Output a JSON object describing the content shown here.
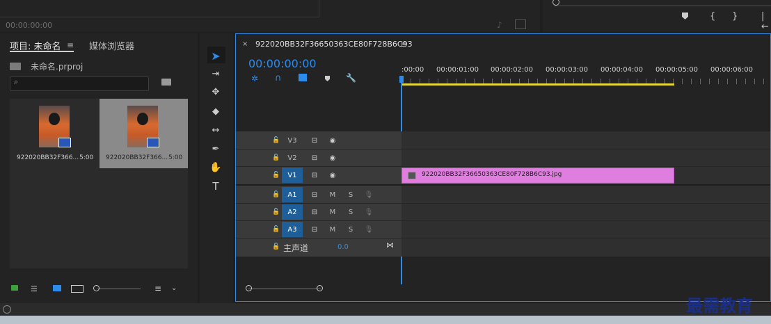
{
  "source_monitor": {
    "timecode": "00:00:00:00"
  },
  "project": {
    "tab_project": "项目: 未命名",
    "tab_media": "媒体浏览器",
    "file_name": "未命名.prproj",
    "search_placeholder": "",
    "items": [
      {
        "name": "922020BB32F366...",
        "duration": "5:00",
        "selected": false
      },
      {
        "name": "922020BB32F366...",
        "duration": "5:00",
        "selected": true
      }
    ]
  },
  "timeline": {
    "sequence_name": "922020BB32F36650363CE80F728B6C93",
    "timecode": "00:00:00:00",
    "ruler": [
      ":00:00",
      "00:00:01:00",
      "00:00:02:00",
      "00:00:03:00",
      "00:00:04:00",
      "00:00:05:00",
      "00:00:06:00"
    ],
    "video_tracks": [
      "V3",
      "V2",
      "V1"
    ],
    "audio_tracks": [
      "A1",
      "A2",
      "A3"
    ],
    "master_label": "主声道",
    "master_value": "0.0",
    "mute": "M",
    "solo": "S",
    "clip_name": "922020BB32F36650363CE80F728B6C93.jpg",
    "clip_color": "#e07ee0"
  },
  "accent": "#2d8ceb",
  "watermark": "最需教育"
}
